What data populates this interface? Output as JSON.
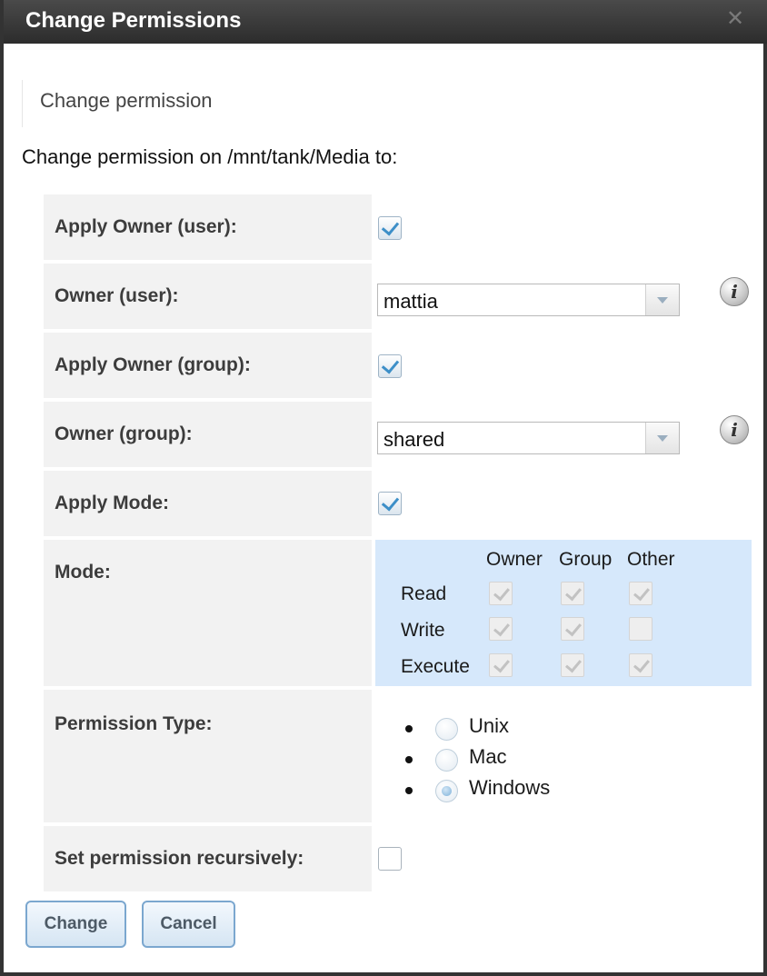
{
  "dialog": {
    "title": "Change Permissions",
    "close_glyph": "✕"
  },
  "tab": {
    "label": "Change permission"
  },
  "intro": "Change permission on /mnt/tank/Media to:",
  "fields": {
    "apply_owner_user": {
      "label": "Apply Owner (user):",
      "checked": true
    },
    "owner_user": {
      "label": "Owner (user):",
      "value": "mattia",
      "icon": "info-icon"
    },
    "apply_owner_group": {
      "label": "Apply Owner (group):",
      "checked": true
    },
    "owner_group": {
      "label": "Owner (group):",
      "value": "shared",
      "icon": "info-icon"
    },
    "apply_mode": {
      "label": "Apply Mode:",
      "checked": true
    },
    "mode": {
      "label": "Mode:",
      "columns": [
        "Owner",
        "Group",
        "Other"
      ],
      "rows": [
        {
          "name": "Read",
          "values": [
            true,
            true,
            true
          ]
        },
        {
          "name": "Write",
          "values": [
            true,
            true,
            false
          ]
        },
        {
          "name": "Execute",
          "values": [
            true,
            true,
            true
          ]
        }
      ]
    },
    "permission_type": {
      "label": "Permission Type:",
      "options": [
        "Unix",
        "Mac",
        "Windows"
      ],
      "selected": "Windows"
    },
    "recursive": {
      "label": "Set permission recursively:",
      "checked": false
    }
  },
  "buttons": {
    "change": "Change",
    "cancel": "Cancel"
  },
  "info_glyph": "i",
  "colors": {
    "accent": "#3d8fc8",
    "mode_panel": "#d6e8fb",
    "titlebar": "#333333"
  }
}
